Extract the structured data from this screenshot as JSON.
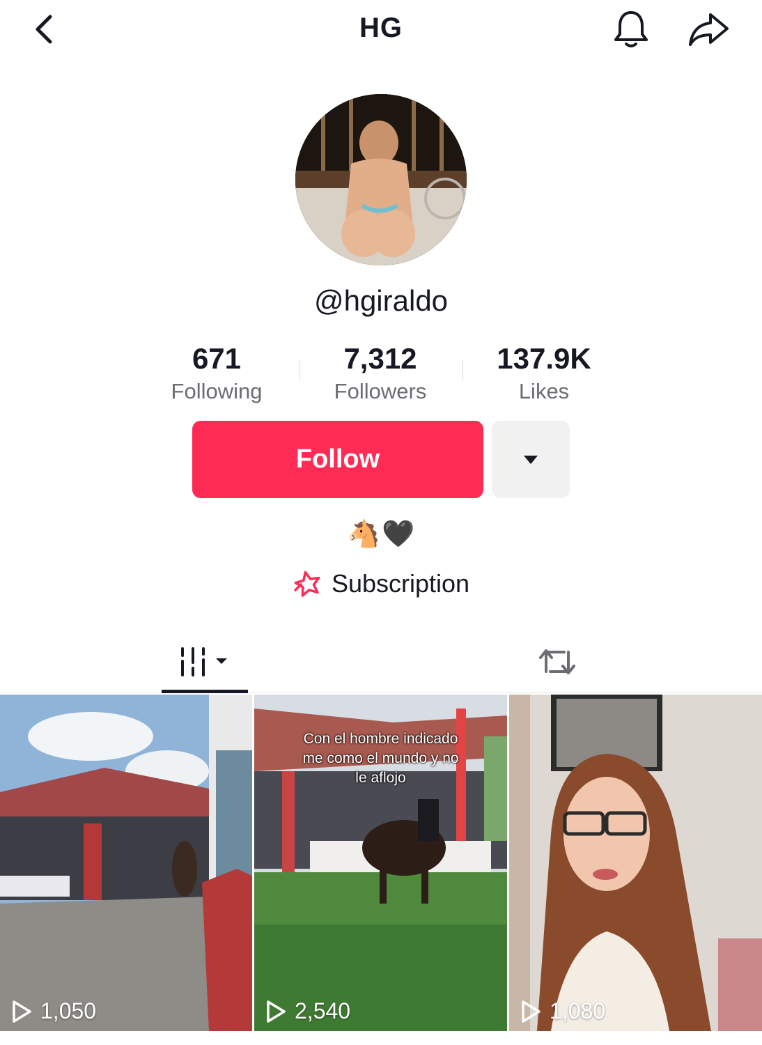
{
  "header": {
    "title": "HG",
    "back_icon": "chevron-left-icon",
    "bell_icon": "bell-icon",
    "share_icon": "share-icon"
  },
  "profile": {
    "username": "@hgiraldo",
    "avatar_icon": "profile-avatar"
  },
  "stats": [
    {
      "value": "671",
      "label": "Following"
    },
    {
      "value": "7,312",
      "label": "Followers"
    },
    {
      "value": "137.9K",
      "label": "Likes"
    }
  ],
  "actions": {
    "follow_label": "Follow",
    "more_icon": "caret-down-icon",
    "follow_color": "#fe2c55"
  },
  "bio": {
    "emoji_1": "🐴",
    "emoji_2": "🖤"
  },
  "subscription": {
    "label": "Subscription",
    "icon": "star-badge-icon",
    "icon_color": "#fe2c55"
  },
  "tabs": [
    {
      "name": "videos",
      "icon": "grid-columns-icon",
      "active": true
    },
    {
      "name": "reposts",
      "icon": "repost-icon",
      "active": false
    }
  ],
  "videos": [
    {
      "views": "1,050",
      "caption": ""
    },
    {
      "views": "2,540",
      "caption": "Con el hombre indicado me como el mundo y no le aflojo"
    },
    {
      "views": "1,080",
      "caption": ""
    }
  ],
  "colors": {
    "text_primary": "#161823",
    "text_secondary": "#6b6d73",
    "accent": "#fe2c55",
    "button_gray": "#f1f1f2"
  }
}
